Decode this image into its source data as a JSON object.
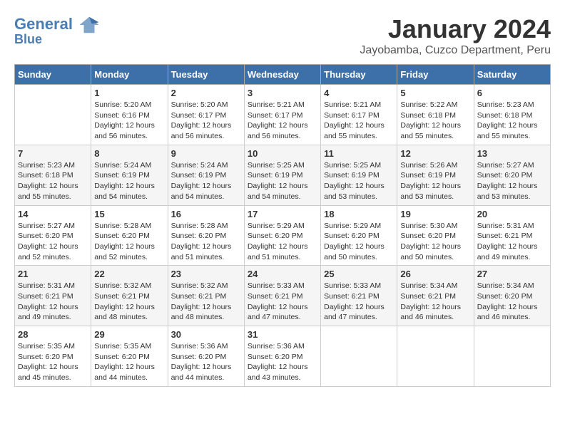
{
  "header": {
    "logo_line1": "General",
    "logo_line2": "Blue",
    "month": "January 2024",
    "location": "Jayobamba, Cuzco Department, Peru"
  },
  "weekdays": [
    "Sunday",
    "Monday",
    "Tuesday",
    "Wednesday",
    "Thursday",
    "Friday",
    "Saturday"
  ],
  "weeks": [
    [
      {
        "day": "",
        "info": ""
      },
      {
        "day": "1",
        "info": "Sunrise: 5:20 AM\nSunset: 6:16 PM\nDaylight: 12 hours\nand 56 minutes."
      },
      {
        "day": "2",
        "info": "Sunrise: 5:20 AM\nSunset: 6:17 PM\nDaylight: 12 hours\nand 56 minutes."
      },
      {
        "day": "3",
        "info": "Sunrise: 5:21 AM\nSunset: 6:17 PM\nDaylight: 12 hours\nand 56 minutes."
      },
      {
        "day": "4",
        "info": "Sunrise: 5:21 AM\nSunset: 6:17 PM\nDaylight: 12 hours\nand 55 minutes."
      },
      {
        "day": "5",
        "info": "Sunrise: 5:22 AM\nSunset: 6:18 PM\nDaylight: 12 hours\nand 55 minutes."
      },
      {
        "day": "6",
        "info": "Sunrise: 5:23 AM\nSunset: 6:18 PM\nDaylight: 12 hours\nand 55 minutes."
      }
    ],
    [
      {
        "day": "7",
        "info": "Sunrise: 5:23 AM\nSunset: 6:18 PM\nDaylight: 12 hours\nand 55 minutes."
      },
      {
        "day": "8",
        "info": "Sunrise: 5:24 AM\nSunset: 6:19 PM\nDaylight: 12 hours\nand 54 minutes."
      },
      {
        "day": "9",
        "info": "Sunrise: 5:24 AM\nSunset: 6:19 PM\nDaylight: 12 hours\nand 54 minutes."
      },
      {
        "day": "10",
        "info": "Sunrise: 5:25 AM\nSunset: 6:19 PM\nDaylight: 12 hours\nand 54 minutes."
      },
      {
        "day": "11",
        "info": "Sunrise: 5:25 AM\nSunset: 6:19 PM\nDaylight: 12 hours\nand 53 minutes."
      },
      {
        "day": "12",
        "info": "Sunrise: 5:26 AM\nSunset: 6:19 PM\nDaylight: 12 hours\nand 53 minutes."
      },
      {
        "day": "13",
        "info": "Sunrise: 5:27 AM\nSunset: 6:20 PM\nDaylight: 12 hours\nand 53 minutes."
      }
    ],
    [
      {
        "day": "14",
        "info": "Sunrise: 5:27 AM\nSunset: 6:20 PM\nDaylight: 12 hours\nand 52 minutes."
      },
      {
        "day": "15",
        "info": "Sunrise: 5:28 AM\nSunset: 6:20 PM\nDaylight: 12 hours\nand 52 minutes."
      },
      {
        "day": "16",
        "info": "Sunrise: 5:28 AM\nSunset: 6:20 PM\nDaylight: 12 hours\nand 51 minutes."
      },
      {
        "day": "17",
        "info": "Sunrise: 5:29 AM\nSunset: 6:20 PM\nDaylight: 12 hours\nand 51 minutes."
      },
      {
        "day": "18",
        "info": "Sunrise: 5:29 AM\nSunset: 6:20 PM\nDaylight: 12 hours\nand 50 minutes."
      },
      {
        "day": "19",
        "info": "Sunrise: 5:30 AM\nSunset: 6:20 PM\nDaylight: 12 hours\nand 50 minutes."
      },
      {
        "day": "20",
        "info": "Sunrise: 5:31 AM\nSunset: 6:21 PM\nDaylight: 12 hours\nand 49 minutes."
      }
    ],
    [
      {
        "day": "21",
        "info": "Sunrise: 5:31 AM\nSunset: 6:21 PM\nDaylight: 12 hours\nand 49 minutes."
      },
      {
        "day": "22",
        "info": "Sunrise: 5:32 AM\nSunset: 6:21 PM\nDaylight: 12 hours\nand 48 minutes."
      },
      {
        "day": "23",
        "info": "Sunrise: 5:32 AM\nSunset: 6:21 PM\nDaylight: 12 hours\nand 48 minutes."
      },
      {
        "day": "24",
        "info": "Sunrise: 5:33 AM\nSunset: 6:21 PM\nDaylight: 12 hours\nand 47 minutes."
      },
      {
        "day": "25",
        "info": "Sunrise: 5:33 AM\nSunset: 6:21 PM\nDaylight: 12 hours\nand 47 minutes."
      },
      {
        "day": "26",
        "info": "Sunrise: 5:34 AM\nSunset: 6:21 PM\nDaylight: 12 hours\nand 46 minutes."
      },
      {
        "day": "27",
        "info": "Sunrise: 5:34 AM\nSunset: 6:20 PM\nDaylight: 12 hours\nand 46 minutes."
      }
    ],
    [
      {
        "day": "28",
        "info": "Sunrise: 5:35 AM\nSunset: 6:20 PM\nDaylight: 12 hours\nand 45 minutes."
      },
      {
        "day": "29",
        "info": "Sunrise: 5:35 AM\nSunset: 6:20 PM\nDaylight: 12 hours\nand 44 minutes."
      },
      {
        "day": "30",
        "info": "Sunrise: 5:36 AM\nSunset: 6:20 PM\nDaylight: 12 hours\nand 44 minutes."
      },
      {
        "day": "31",
        "info": "Sunrise: 5:36 AM\nSunset: 6:20 PM\nDaylight: 12 hours\nand 43 minutes."
      },
      {
        "day": "",
        "info": ""
      },
      {
        "day": "",
        "info": ""
      },
      {
        "day": "",
        "info": ""
      }
    ]
  ]
}
